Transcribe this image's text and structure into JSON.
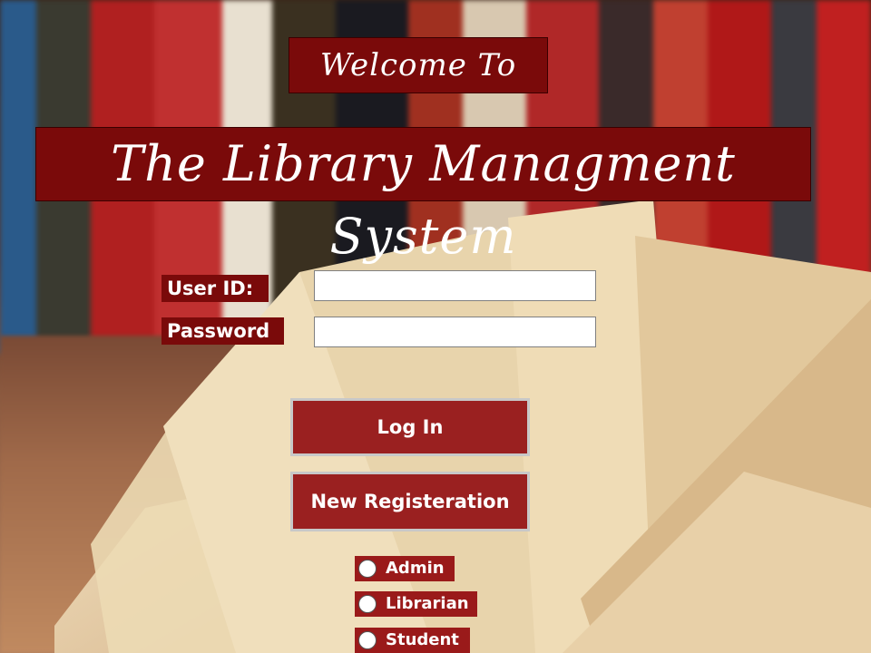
{
  "header": {
    "welcome": "Welcome To",
    "title": "The Library Managment System"
  },
  "form": {
    "user_id_label": "User ID:",
    "user_id_value": "",
    "password_label": "Password",
    "password_value": ""
  },
  "buttons": {
    "login": "Log In",
    "register": "New Registeration"
  },
  "roles": [
    {
      "label": "Admin",
      "selected": false
    },
    {
      "label": "Librarian",
      "selected": false
    },
    {
      "label": "Student",
      "selected": false
    }
  ],
  "colors": {
    "banner": "#7a0a0a",
    "button": "#9a2020",
    "button_border": "#c8c8c8",
    "text": "#ffffff"
  },
  "icons": [
    "radio-unselected-icon"
  ]
}
